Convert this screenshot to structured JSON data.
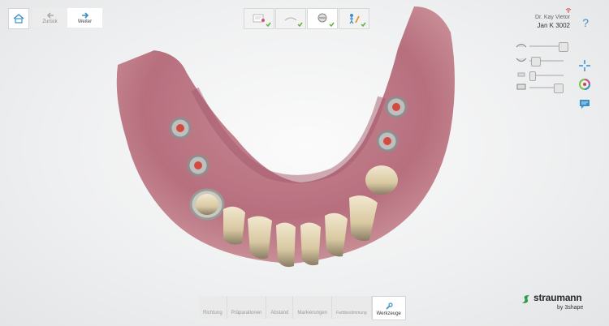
{
  "nav": {
    "back_label": "Zurück",
    "next_label": "Weiter",
    "home_icon": "home-icon",
    "back_icon": "arrow-left-icon",
    "next_icon": "arrow-right-icon"
  },
  "workflow": {
    "steps": [
      {
        "name": "order-form",
        "completed": true
      },
      {
        "name": "scan-setup",
        "completed": true
      },
      {
        "name": "scan",
        "completed": true,
        "active": true
      },
      {
        "name": "send",
        "completed": true
      }
    ]
  },
  "patient": {
    "doctor": "Dr. Kay Vietor",
    "case": "Jan K 3002"
  },
  "sliders": [
    {
      "name": "slider-1",
      "level": 0.9
    },
    {
      "name": "slider-2",
      "level": 0.1
    },
    {
      "name": "slider-3",
      "level": 0.05
    },
    {
      "name": "slider-4",
      "level": 0.85
    }
  ],
  "bottom_toolbar": {
    "items": [
      {
        "label": "Richtung",
        "active": false
      },
      {
        "label": "Präparationen",
        "active": false
      },
      {
        "label": "Abstand",
        "active": false
      },
      {
        "label": "Markierungen",
        "active": false
      },
      {
        "label": "Farbbestimmung",
        "active": false
      },
      {
        "label": "Werkzeuge",
        "active": true
      }
    ]
  },
  "brand": {
    "name": "straumann",
    "by": "by 3shape",
    "accent": "#3a8fc7",
    "check_color": "#5fb33a"
  }
}
